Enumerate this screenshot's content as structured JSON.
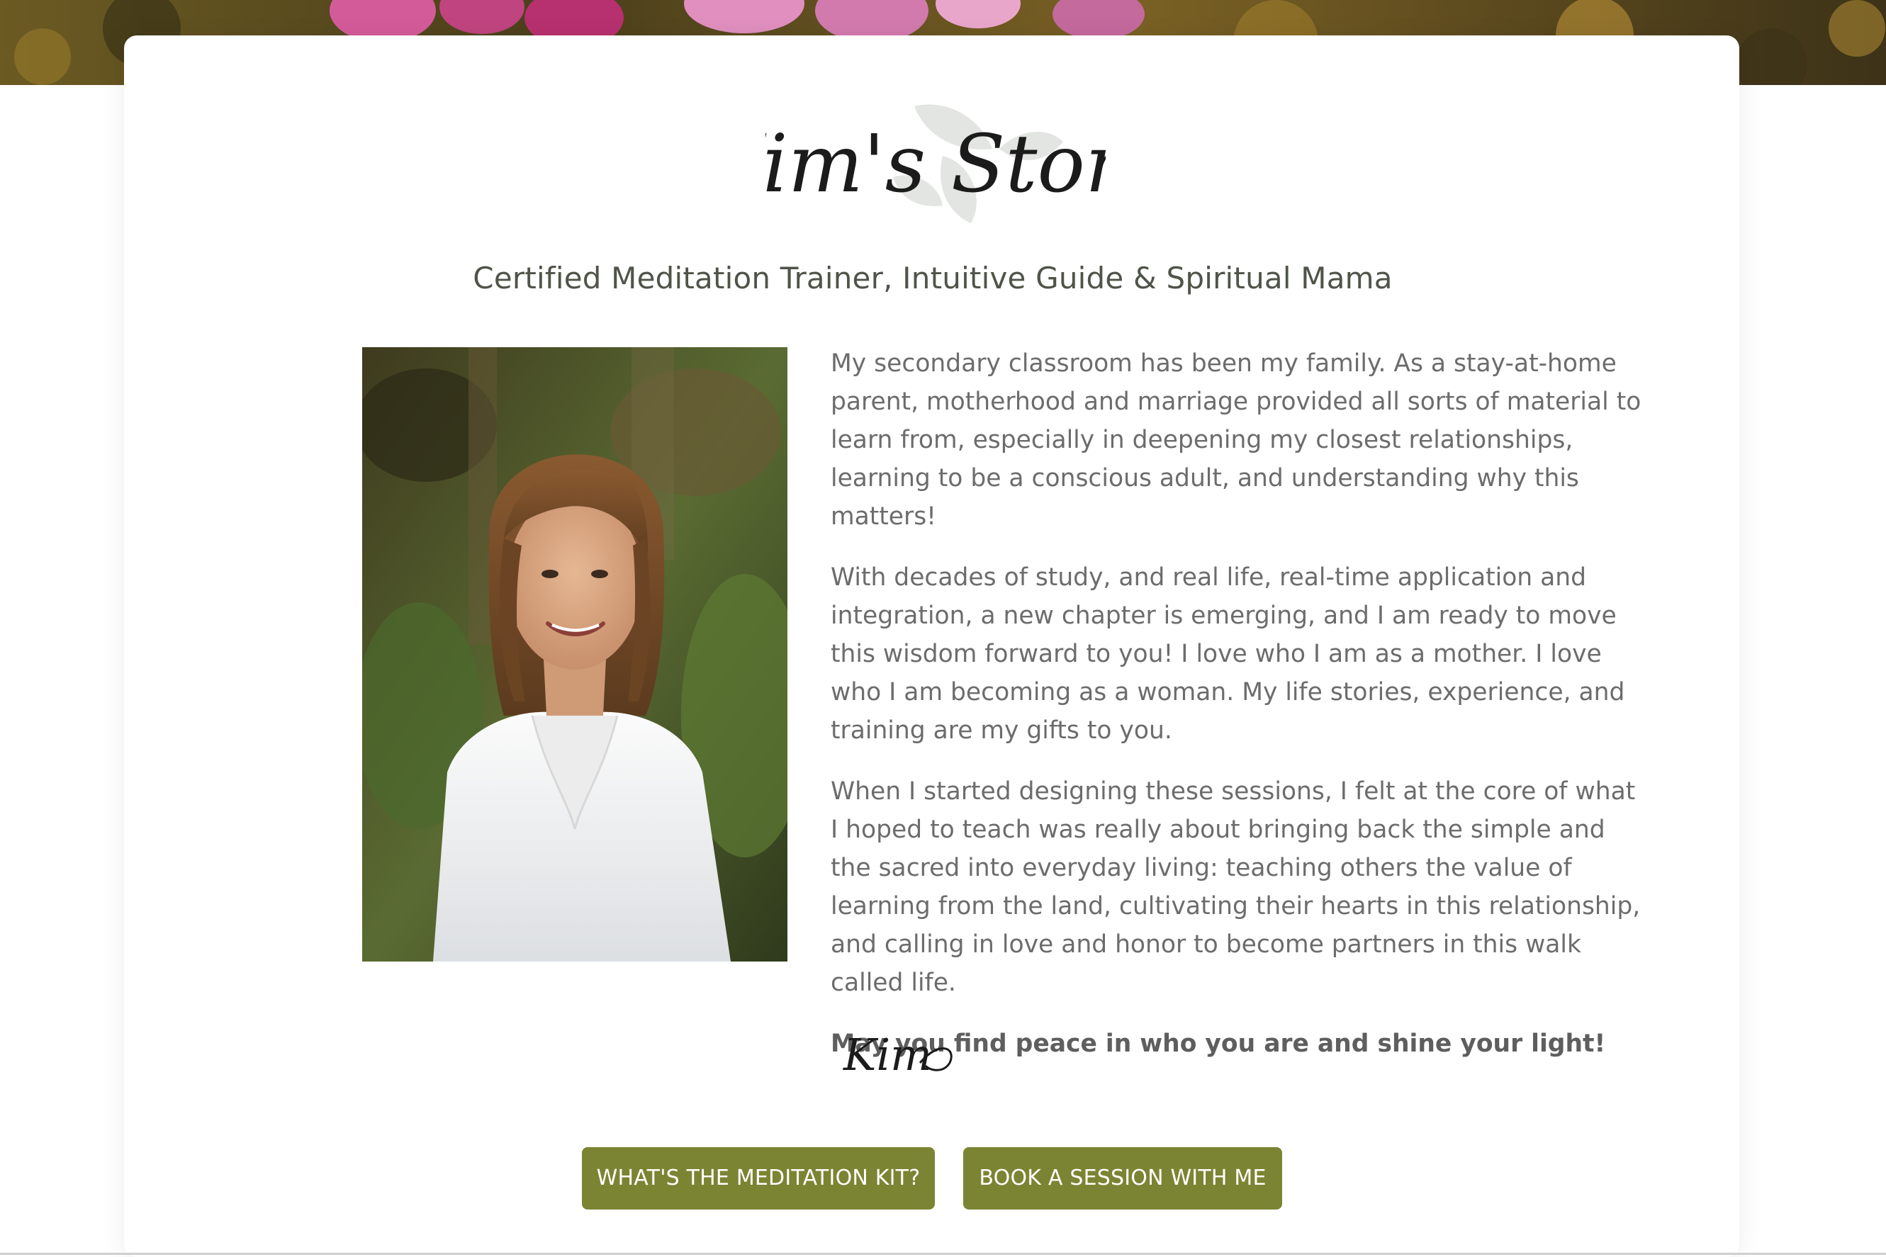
{
  "hero": {
    "image_icon": "floral-banner-image"
  },
  "header": {
    "title": "Kim's Story",
    "subtitle": "Certified Meditation Trainer, Intuitive Guide & Spiritual Mama"
  },
  "photo": {
    "icon": "portrait-photo"
  },
  "content": {
    "paragraphs": [
      "My secondary classroom has been my family. As a stay-at-home parent, motherhood and marriage provided all sorts of material to learn from, especially in deepening my closest relationships, learning to be a conscious adult, and understanding why this matters!",
      "With decades of study, and real life, real-time application and integration, a new chapter is emerging, and I am ready to move this wisdom forward to you! I love who I am as a mother. I love who I am becoming as a woman. My life stories, experience, and training are my gifts to you.",
      "When I started designing these sessions, I felt at the core of what I hoped to teach was really about bringing back the simple and the sacred into everyday living: teaching others the value of learning from the land, cultivating their hearts in this relationship, and calling in love and honor to become partners in this walk called life."
    ],
    "closing": "May you find peace in who you are and shine your light!",
    "signature": "Kim"
  },
  "buttons": {
    "kit_label": "WHAT'S THE MEDITATION KIT?",
    "book_label": "BOOK A SESSION WITH ME"
  },
  "colors": {
    "button_bg": "#7b8432",
    "subtitle_text": "#4f5449",
    "body_text": "#6c6c6c"
  }
}
